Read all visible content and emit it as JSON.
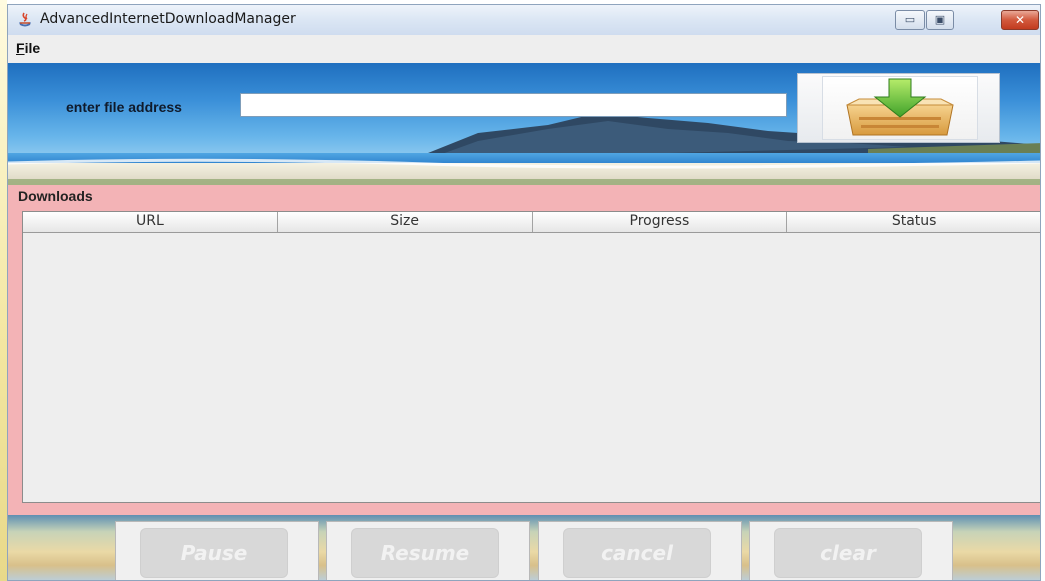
{
  "window": {
    "title": "AdvancedInternetDownloadManager",
    "controls": {
      "minimize": "▭",
      "maximize": "▣",
      "close": "✕"
    }
  },
  "menu": {
    "items": [
      {
        "mnemonic": "F",
        "rest": "ile"
      }
    ]
  },
  "banner": {
    "url_label": "enter file address",
    "url_value": "",
    "download_icon": "download-box-icon"
  },
  "downloads": {
    "title": "Downloads",
    "columns": [
      "URL",
      "Size",
      "Progress",
      "Status"
    ],
    "rows": []
  },
  "actions": {
    "pause": "Pause",
    "resume": "Resume",
    "cancel": "cancel",
    "clear": "clear"
  },
  "colors": {
    "panel_accent": "#f3b3b6",
    "disabled_button": "#d8d8d8"
  }
}
